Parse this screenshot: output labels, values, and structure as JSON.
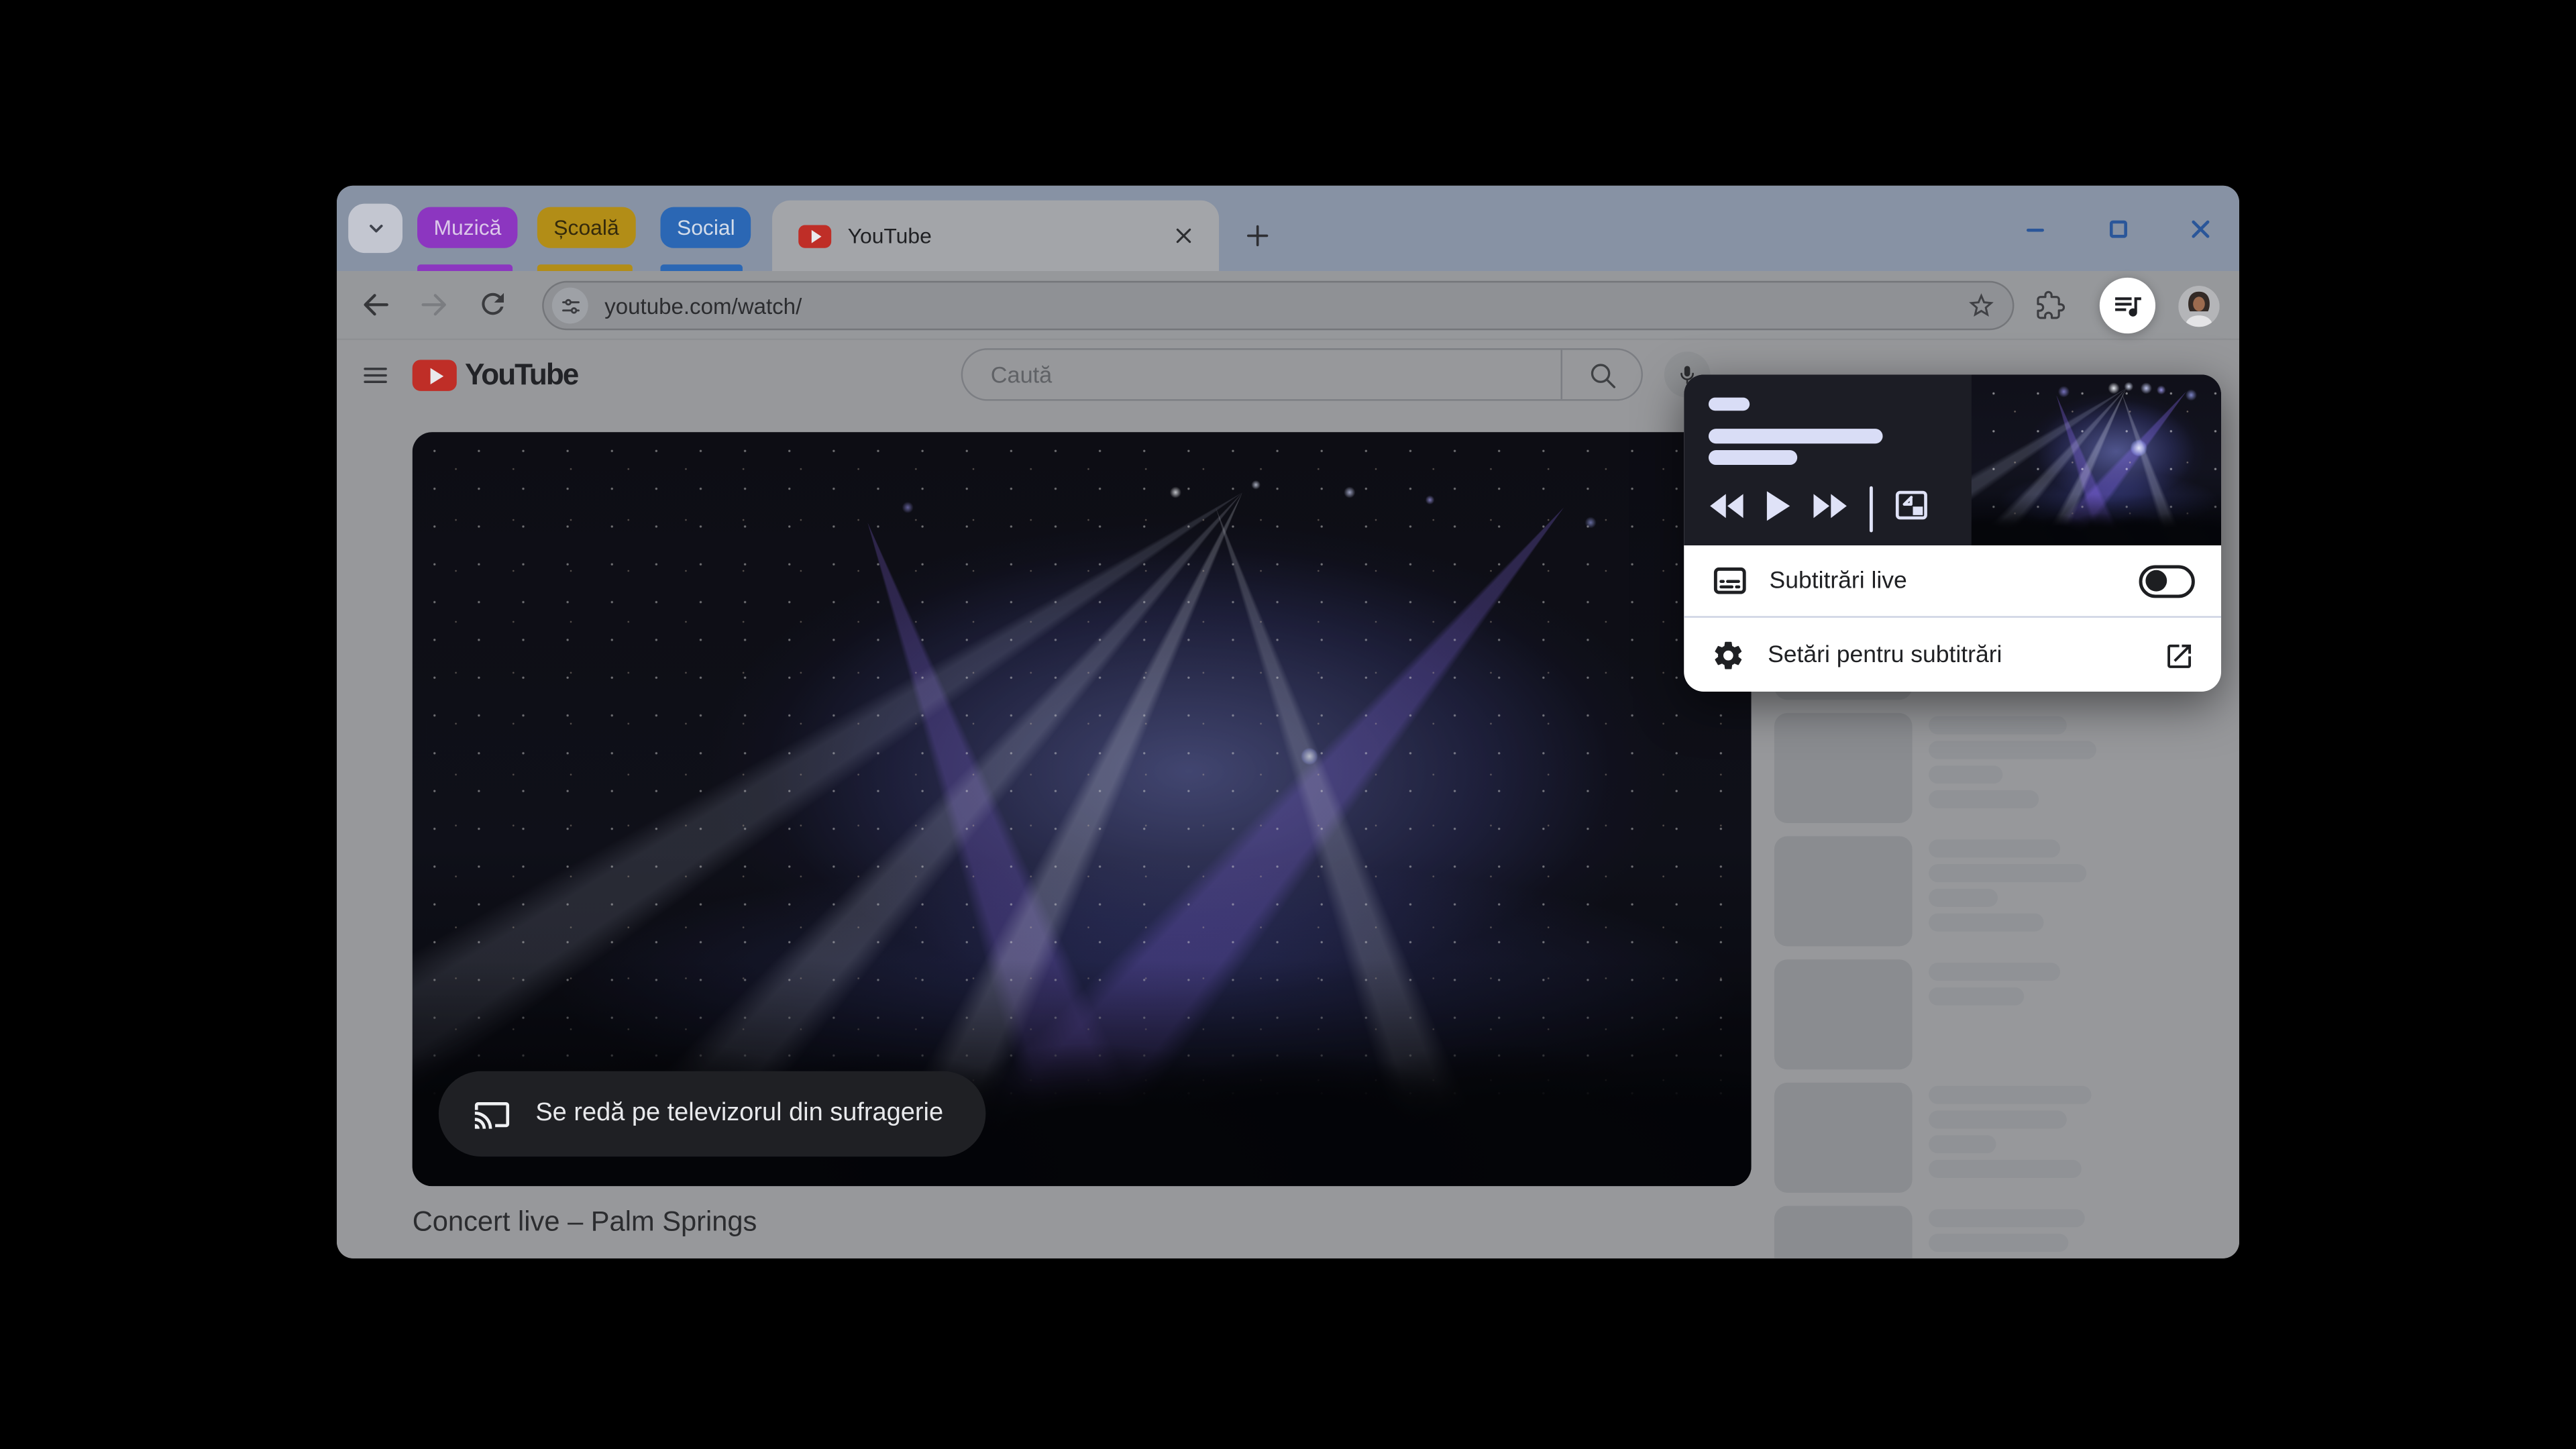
{
  "window": {
    "controls": {
      "minimize": "minimize",
      "maximize": "maximize",
      "close": "close",
      "accent_color": "#2a5699"
    }
  },
  "tab_strip": {
    "tab_groups": [
      {
        "label": "Muzică",
        "color": "#8c36c0"
      },
      {
        "label": "Școală",
        "color": "#b28d17"
      },
      {
        "label": "Social",
        "color": "#2b67b4"
      }
    ],
    "active_tab": {
      "title": "YouTube",
      "favicon": "youtube-play",
      "favicon_color": "#bf2e27"
    }
  },
  "toolbar": {
    "url": "youtube.com/watch/",
    "icons": [
      "back-arrow",
      "forward-arrow",
      "reload",
      "site-settings-tune",
      "bookmark-star",
      "extensions-puzzle",
      "media-controls-queue-music",
      "profile-avatar"
    ]
  },
  "youtube": {
    "logo_text": "YouTube",
    "search_placeholder": "Caută",
    "video_title": "Concert live – Palm Springs",
    "cast_overlay_text": "Se redă pe televizorul din sufragerie",
    "logo_red": "#bf2e27"
  },
  "media_popup": {
    "controls": [
      "rewind",
      "play",
      "fast-forward",
      "picture-in-picture"
    ],
    "rows": [
      {
        "label": "Subtitrări live",
        "icon": "subtitles",
        "toggle_state": "off"
      },
      {
        "label": "Setări pentru subtitrări",
        "icon": "settings-gear",
        "action_icon": "open-in-new"
      }
    ]
  }
}
